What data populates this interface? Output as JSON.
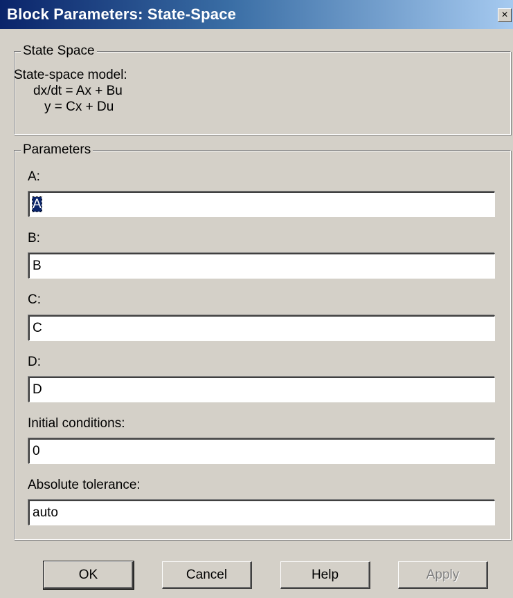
{
  "window": {
    "title": "Block Parameters: State-Space",
    "close_glyph": "×"
  },
  "description_group": {
    "legend": "State Space",
    "lines": [
      "State-space model:",
      "dx/dt = Ax + Bu",
      "y = Cx + Du"
    ]
  },
  "parameters_group": {
    "legend": "Parameters",
    "fields": [
      {
        "label": "A:",
        "value": "A"
      },
      {
        "label": "B:",
        "value": "B"
      },
      {
        "label": "C:",
        "value": "C"
      },
      {
        "label": "D:",
        "value": "D"
      },
      {
        "label": "Initial conditions:",
        "value": "0"
      },
      {
        "label": "Absolute tolerance:",
        "value": "auto"
      }
    ]
  },
  "buttons": {
    "ok": "OK",
    "cancel": "Cancel",
    "help": "Help",
    "apply": "Apply"
  }
}
